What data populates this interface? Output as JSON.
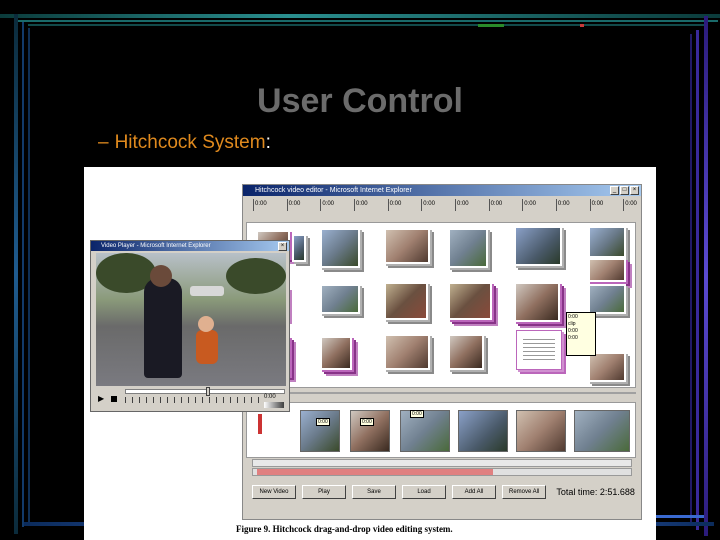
{
  "slide": {
    "title": "User Control",
    "bullet_dash": "–",
    "bullet_text": "Hitchcock System",
    "bullet_colon": ":"
  },
  "editor": {
    "title": "Hitchcock video editor - Microsoft Internet Explorer",
    "timeline_ticks": [
      "0:00",
      "0:00",
      "0:00",
      "0:00",
      "0:00",
      "0:00",
      "0:00",
      "0:00",
      "0:00",
      "0:00",
      "0:00",
      "0:00"
    ],
    "tooltip_lines": [
      "0:00",
      "clip",
      "0:00",
      "0:00"
    ],
    "storyboard_badges": [
      "0:00",
      "0:00",
      "0:00"
    ],
    "buttons": [
      "New Video",
      "Play",
      "Save",
      "Load",
      "Add All",
      "Remove All"
    ],
    "total_time": "Total time: 2:51.688"
  },
  "player": {
    "title": "Video Player - Microsoft Internet Explorer",
    "time": "0:00",
    "progress": 0.52
  },
  "figure": {
    "caption_label": "Figure 9.",
    "caption_text": "Hitchcock drag-and-drop video editing system."
  },
  "colors": {
    "title_gray": "#6b6b6b",
    "bullet_orange": "#e08a1e",
    "pile_purple": "#bb66bb"
  }
}
